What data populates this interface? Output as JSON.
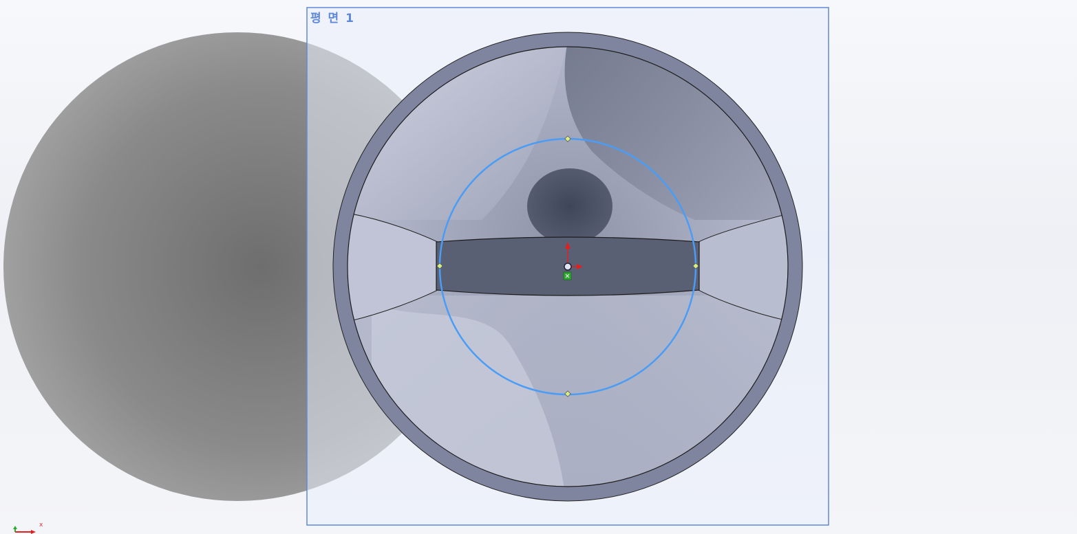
{
  "plane": {
    "label": "평 면 1",
    "color": "#5e89d8"
  },
  "sketch": {
    "circle_color": "#4a9cf5",
    "endpoint_color": "#d8f080"
  },
  "origin": {
    "y_axis_color": "#e02020",
    "x_axis_color": "#e02020",
    "fixed_marker_color": "#2fa82f"
  },
  "triad": {
    "x_label": "x"
  },
  "colors": {
    "shadow": "#7a7a7a",
    "rim": "#7f859f",
    "bowl_light": "#c8ccdc",
    "bowl_dark": "#4c5262",
    "bar": "#5a6074"
  }
}
